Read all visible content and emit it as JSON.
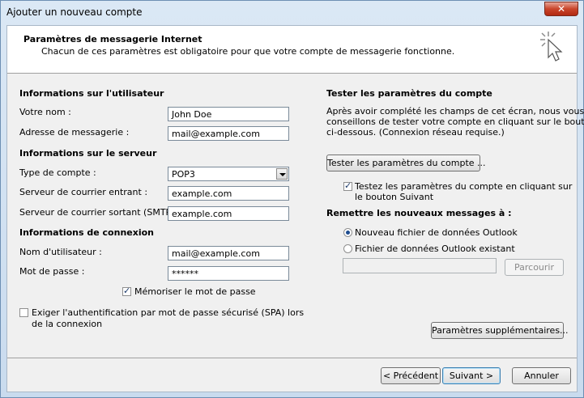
{
  "window": {
    "title": "Ajouter un nouveau compte",
    "close_icon": "close-icon"
  },
  "header": {
    "title": "Paramètres de messagerie Internet",
    "subtitle": "Chacun de ces paramètres est obligatoire pour que votre compte de messagerie fonctionne.",
    "icon": "cursor-click-icon"
  },
  "user_info": {
    "section": "Informations sur l'utilisateur",
    "name_label": "Votre nom :",
    "name_value": "John Doe",
    "email_label": "Adresse de messagerie :",
    "email_value": "mail@example.com"
  },
  "server_info": {
    "section": "Informations sur le serveur",
    "type_label": "Type de compte :",
    "type_value": "POP3",
    "incoming_label": "Serveur de courrier entrant :",
    "incoming_value": "example.com",
    "outgoing_label": "Serveur de courrier sortant (SMTP) :",
    "outgoing_value": "example.com"
  },
  "logon_info": {
    "section": "Informations de connexion",
    "user_label": "Nom d'utilisateur :",
    "user_value": "mail@example.com",
    "password_label": "Mot de passe :",
    "password_value": "******",
    "remember_label": "Mémoriser le mot de passe",
    "remember_checked": true,
    "spa_label_1": "Exiger l'authentification par mot de passe sécurisé (SPA) lors",
    "spa_label_2": "de la connexion",
    "spa_checked": false
  },
  "test": {
    "section": "Tester les paramètres du compte",
    "desc_1": "Après avoir complété les champs de cet écran, nous vous",
    "desc_2": "conseillons de tester votre compte en cliquant sur le bouton",
    "desc_3": "ci-dessous. (Connexion réseau requise.)",
    "button": "Tester les paramètres du compte ...",
    "auto_label_1": "Testez les paramètres du compte en cliquant sur",
    "auto_label_2": "le bouton Suivant",
    "auto_checked": true
  },
  "deliver": {
    "section": "Remettre les nouveaux messages à :",
    "new_file_label": "Nouveau fichier de données Outlook",
    "existing_file_label": "Fichier de données Outlook existant",
    "selected": "new",
    "browse_button": "Parcourir",
    "more_settings_button": "Paramètres supplémentaires..."
  },
  "footer": {
    "back": "< Précédent",
    "next": "Suivant >",
    "cancel": "Annuler"
  },
  "colors": {
    "title_bar": "#c9dbee",
    "close_button": "#c9452b",
    "dialog_bg": "#f0f0f0",
    "default_button_border": "#3c7fb1"
  }
}
